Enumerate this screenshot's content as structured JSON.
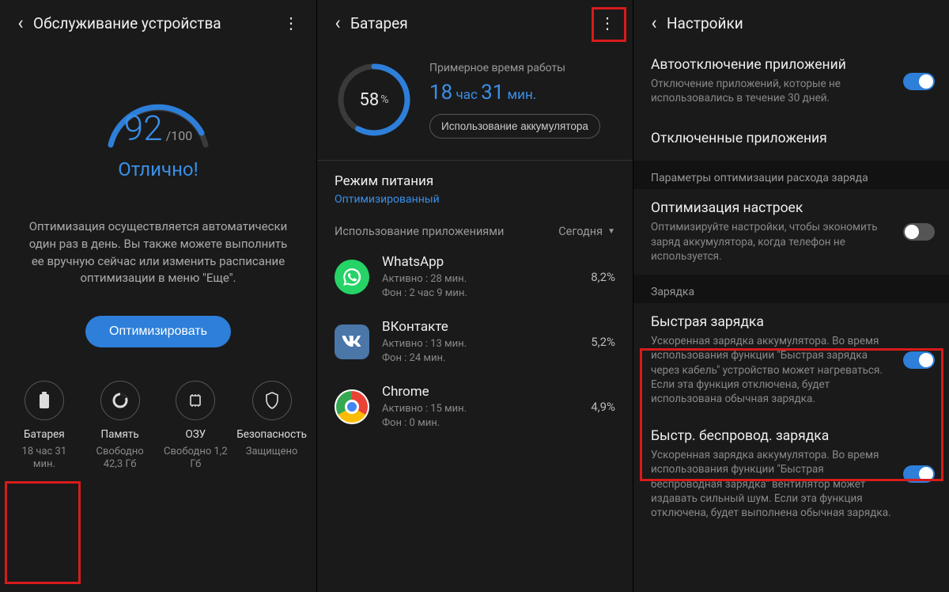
{
  "panel1": {
    "title": "Обслуживание устройства",
    "score": "92",
    "scoreMax": "/100",
    "status": "Отлично!",
    "desc": "Оптимизация осуществляется автоматически один раз в день. Вы также можете выполнить ее вручную сейчас или изменить расписание оптимизации в меню \"Еще\".",
    "optimizeBtn": "Оптимизировать",
    "tiles": [
      {
        "label": "Батарея",
        "sub": "18 час 31 мин."
      },
      {
        "label": "Память",
        "sub": "Свободно 42,3 Гб"
      },
      {
        "label": "ОЗУ",
        "sub": "Свободно 1,2 Гб"
      },
      {
        "label": "Безопасность",
        "sub": "Защищено"
      }
    ]
  },
  "panel2": {
    "title": "Батарея",
    "percent": "58",
    "estLabel": "Примерное время работы",
    "estHours": "18",
    "estHoursUnit": "час",
    "estMins": "31",
    "estMinsUnit": "мин.",
    "usageBtn": "Использование аккумулятора",
    "powerModeTitle": "Режим питания",
    "powerModeValue": "Оптимизированный",
    "usageByApps": "Использование приложениями",
    "today": "Сегодня",
    "apps": [
      {
        "name": "WhatsApp",
        "active": "Активно : 28 мин.",
        "bg": "Фон : 2 час 9 мин.",
        "pct": "8,2%"
      },
      {
        "name": "ВКонтакте",
        "active": "Активно : 13 мин.",
        "bg": "Фон : 24 мин.",
        "pct": "5,2%"
      },
      {
        "name": "Chrome",
        "active": "Активно : 15 мин.",
        "bg": "Фон : 0 мин.",
        "pct": "4,9%"
      }
    ]
  },
  "panel3": {
    "title": "Настройки",
    "items": {
      "autoDisable": {
        "title": "Автоотключение приложений",
        "desc": "Отключение приложений, которые не использовались в течение 30 дней."
      },
      "disabledApps": {
        "title": "Отключенные приложения"
      },
      "optGroup": "Параметры оптимизации расхода заряда",
      "optSettings": {
        "title": "Оптимизация настроек",
        "desc": "Оптимизируйте настройки, чтобы экономить заряд аккумулятора, когда телефон не используется."
      },
      "chargeGroup": "Зарядка",
      "fastCharge": {
        "title": "Быстрая зарядка",
        "desc": "Ускоренная зарядка аккумулятора. Во время использования функции \"Быстрая зарядка через кабель\" устройство может нагреваться. Если эта функция отключена, будет использована обычная зарядка."
      },
      "fastWireless": {
        "title": "Быстр. беспровод. зарядка",
        "desc": "Ускоренная зарядка аккумулятора. Во время использования функции \"Быстрая беспроводная зарядка\" вентилятор может издавать сильный шум. Если эта функция отключена, будет выполнена обычная зарядка."
      }
    }
  }
}
